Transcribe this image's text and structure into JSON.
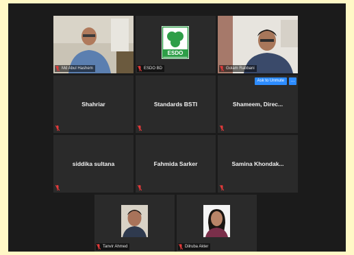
{
  "participants": [
    {
      "name": "Md Abul Hashem",
      "type": "video"
    },
    {
      "name": "ESDO BD",
      "type": "logo",
      "logo_text": "ESDO"
    },
    {
      "name": "Golam Rabbani",
      "type": "video"
    },
    {
      "name": "Shahriar",
      "type": "name"
    },
    {
      "name": "Standards BSTI",
      "type": "name"
    },
    {
      "name": "Shameem,  Direc...",
      "type": "name"
    },
    {
      "name": "siddika sultana",
      "type": "name"
    },
    {
      "name": "Fahmida Sarker",
      "type": "name"
    },
    {
      "name": "Samina  Khondak...",
      "type": "name"
    },
    {
      "name": "Tanvir Ahmed",
      "type": "photo"
    },
    {
      "name": "Dilruba Akter",
      "type": "photo"
    }
  ],
  "controls": {
    "ask_to_unmute_label": "Ask to Unmute",
    "more_label": "..."
  },
  "colors": {
    "active_speaker_border": "#c5d93a",
    "muted_mic": "#e23b3b",
    "button_blue": "#2d8cff",
    "esdo_green": "#2e9e48"
  },
  "icons": {
    "mic": "muted-mic-icon"
  }
}
